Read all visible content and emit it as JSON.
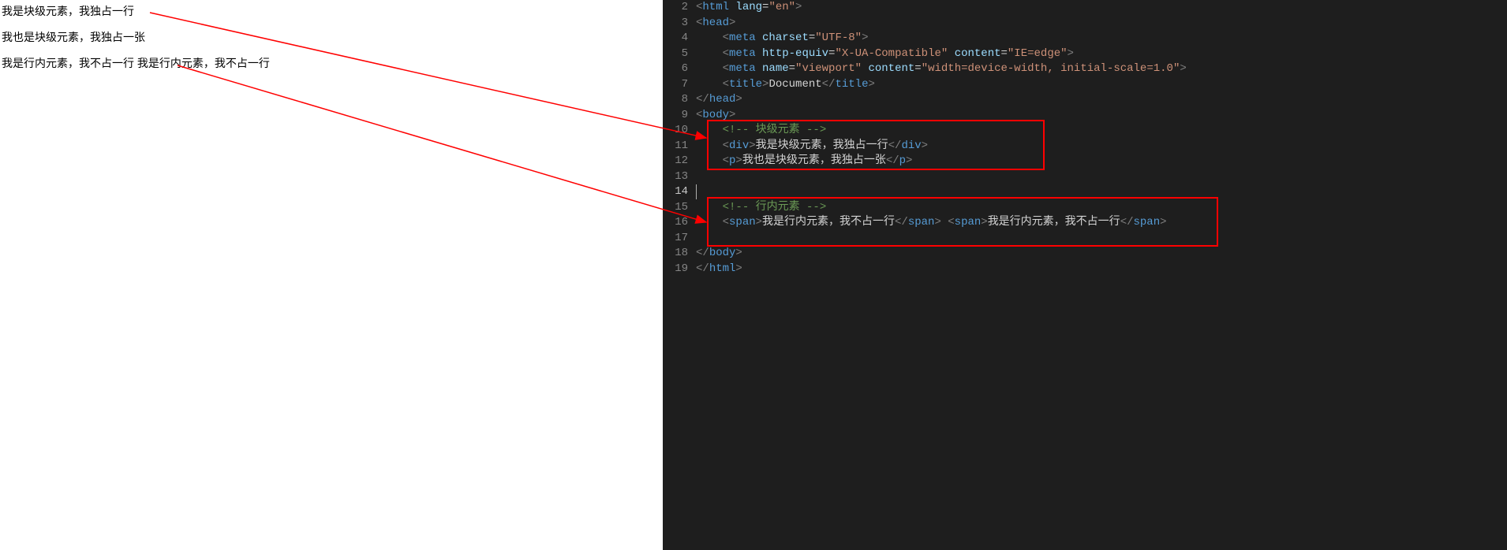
{
  "preview": {
    "div_text": "我是块级元素，我独占一行",
    "p_text": "我也是块级元素，我独占一张",
    "span1": "我是行内元素，我不占一行",
    "span_gap": " ",
    "span2": "我是行内元素，我不占一行"
  },
  "editor": {
    "first_visible_line": 2,
    "cursor_line": 14,
    "tokens": {
      "html": "html",
      "lang": "lang",
      "en": "\"en\"",
      "head": "head",
      "meta": "meta",
      "charset": "charset",
      "utf8": "\"UTF-8\"",
      "httpequiv": "http-equiv",
      "xua": "\"X-UA-Compatible\"",
      "content": "content",
      "ieedge": "\"IE=edge\"",
      "name": "name",
      "viewport": "\"viewport\"",
      "vpcontent": "\"width=device-width, initial-scale=1.0\"",
      "title": "title",
      "doc": "Document",
      "body": "body",
      "cmt_block": "<!-- 块级元素 -->",
      "div": "div",
      "div_text": "我是块级元素，我独占一行",
      "p": "p",
      "p_text": "我也是块级元素，我独占一张",
      "cmt_inline": "<!-- 行内元素 -->",
      "span": "span",
      "span_text": "我是行内元素，我不占一行"
    },
    "line_numbers": [
      2,
      3,
      4,
      5,
      6,
      7,
      8,
      9,
      10,
      11,
      12,
      13,
      14,
      15,
      16,
      17,
      18,
      19
    ]
  },
  "annotations": {
    "box1": {
      "desc": "block-elements-highlight"
    },
    "box2": {
      "desc": "inline-elements-highlight"
    }
  }
}
